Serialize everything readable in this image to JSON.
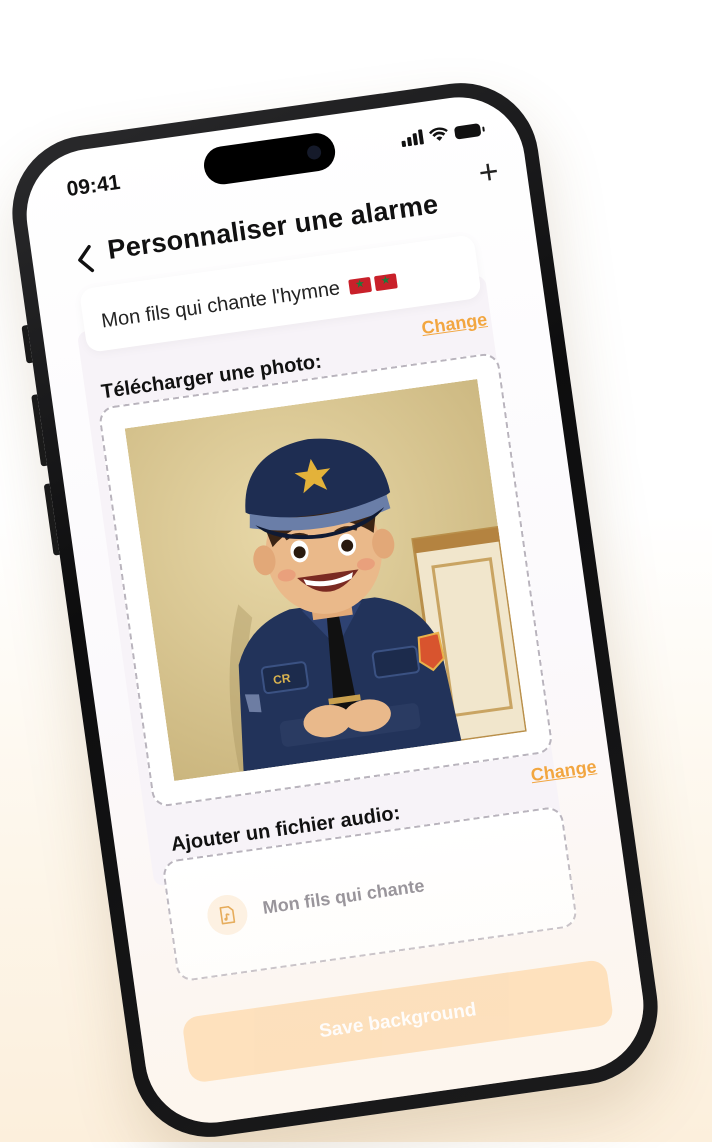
{
  "status_bar": {
    "time": "09:41"
  },
  "header": {
    "title": "Personnaliser une alarme",
    "back_icon": "chevron-left-icon",
    "add_icon": "plus-icon"
  },
  "alarm_name": {
    "text": "Mon fils qui chante l'hymne",
    "flag_icon": "morocco-flag-icon"
  },
  "photo_section": {
    "label": "Télécharger une photo:",
    "change_label": "Change",
    "image": "boy-in-police-uniform-illustration"
  },
  "audio_section": {
    "label": "Ajouter un fichier audio:",
    "change_label": "Change",
    "file_name": "Mon fils qui chante",
    "file_icon": "audio-file-icon"
  },
  "footer": {
    "save_label": "Save background"
  },
  "colors": {
    "accent": "#f2a640",
    "save_button": "#fdd9ac",
    "dashed_border": "#b9b4bd"
  }
}
